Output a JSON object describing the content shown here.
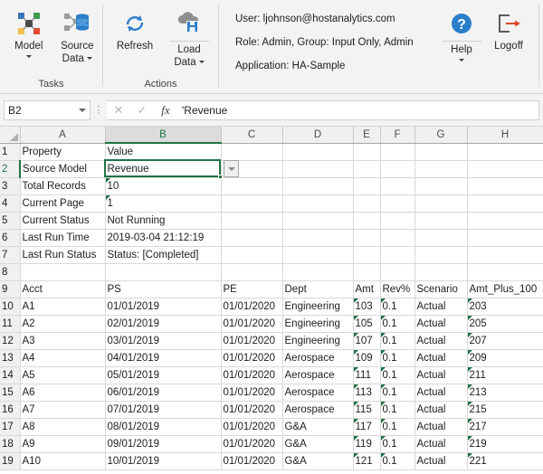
{
  "ribbon": {
    "groups": [
      {
        "label": "Tasks",
        "buttons": [
          {
            "label_line1": "Model",
            "label_line2": "",
            "icon": "model-nodes-icon",
            "has_caret": true
          },
          {
            "label_line1": "Source",
            "label_line2": "Data",
            "icon": "source-database-icon",
            "has_caret": true
          }
        ]
      },
      {
        "label": "Actions",
        "buttons": [
          {
            "label_line1": "Refresh",
            "label_line2": "",
            "icon": "refresh-icon",
            "has_caret": false
          },
          {
            "label_line1": "Load",
            "label_line2": "Data",
            "icon": "cloud-save-icon",
            "has_caret": true
          }
        ]
      }
    ],
    "info": {
      "user": "User: ljohnson@hostanalytics.com",
      "role": "Role: Admin, Group: Input Only, Admin",
      "application": "Application: HA-Sample"
    },
    "tools": [
      {
        "label": "Help",
        "icon": "help-question-icon",
        "has_caret": true
      },
      {
        "label": "Logoff",
        "icon": "logoff-arrow-icon",
        "has_caret": false
      }
    ]
  },
  "formula_bar": {
    "name_box_value": "B2",
    "cancel_icon": "✕",
    "confirm_icon": "✓",
    "fx_icon": "fx",
    "formula_value": "'Revenue"
  },
  "sheet": {
    "columns": [
      {
        "label": "A",
        "width": 94,
        "selected": false
      },
      {
        "label": "B",
        "width": 128,
        "selected": true
      },
      {
        "label": "C",
        "width": 68,
        "selected": false
      },
      {
        "label": "D",
        "width": 78,
        "selected": false
      },
      {
        "label": "E",
        "width": 30,
        "selected": false
      },
      {
        "label": "F",
        "width": 38,
        "selected": false
      },
      {
        "label": "G",
        "width": 58,
        "selected": false
      },
      {
        "label": "H",
        "width": 84,
        "selected": false
      }
    ],
    "rows": [
      {
        "num": "1",
        "selected": false,
        "cells": [
          {
            "v": "Property",
            "style": "bold"
          },
          {
            "v": "Value",
            "style": "bold"
          },
          {
            "v": ""
          },
          {
            "v": ""
          },
          {
            "v": ""
          },
          {
            "v": ""
          },
          {
            "v": ""
          },
          {
            "v": ""
          }
        ]
      },
      {
        "num": "2",
        "selected": true,
        "cells": [
          {
            "v": "Source Model",
            "style": "bold"
          },
          {
            "v": "Revenue"
          },
          {
            "v": ""
          },
          {
            "v": ""
          },
          {
            "v": ""
          },
          {
            "v": ""
          },
          {
            "v": ""
          },
          {
            "v": ""
          }
        ]
      },
      {
        "num": "3",
        "selected": false,
        "cells": [
          {
            "v": "Total Records",
            "style": "bold"
          },
          {
            "v": "10",
            "style": "gray",
            "err": true
          },
          {
            "v": ""
          },
          {
            "v": ""
          },
          {
            "v": ""
          },
          {
            "v": ""
          },
          {
            "v": ""
          },
          {
            "v": ""
          }
        ]
      },
      {
        "num": "4",
        "selected": false,
        "cells": [
          {
            "v": "Current Page",
            "style": "bold"
          },
          {
            "v": "1",
            "err": true
          },
          {
            "v": ""
          },
          {
            "v": ""
          },
          {
            "v": ""
          },
          {
            "v": ""
          },
          {
            "v": ""
          },
          {
            "v": ""
          }
        ]
      },
      {
        "num": "5",
        "selected": false,
        "cells": [
          {
            "v": "Current Status",
            "style": "bold"
          },
          {
            "v": "Not Running",
            "style": "gray"
          },
          {
            "v": ""
          },
          {
            "v": ""
          },
          {
            "v": ""
          },
          {
            "v": ""
          },
          {
            "v": ""
          },
          {
            "v": ""
          }
        ]
      },
      {
        "num": "6",
        "selected": false,
        "cells": [
          {
            "v": "Last Run Time",
            "style": "bold"
          },
          {
            "v": "2019-03-04 21:12:19",
            "style": "gray"
          },
          {
            "v": ""
          },
          {
            "v": ""
          },
          {
            "v": ""
          },
          {
            "v": ""
          },
          {
            "v": ""
          },
          {
            "v": ""
          }
        ]
      },
      {
        "num": "7",
        "selected": false,
        "cells": [
          {
            "v": "Last Run Status",
            "style": "bold"
          },
          {
            "v": "Status: [Completed]"
          },
          {
            "v": ""
          },
          {
            "v": ""
          },
          {
            "v": ""
          },
          {
            "v": ""
          },
          {
            "v": ""
          },
          {
            "v": ""
          }
        ]
      },
      {
        "num": "8",
        "selected": false,
        "cells": [
          {
            "v": ""
          },
          {
            "v": ""
          },
          {
            "v": ""
          },
          {
            "v": ""
          },
          {
            "v": ""
          },
          {
            "v": ""
          },
          {
            "v": ""
          },
          {
            "v": ""
          }
        ]
      },
      {
        "num": "9",
        "selected": false,
        "cells": [
          {
            "v": "Acct",
            "style": "bold"
          },
          {
            "v": "PS",
            "style": "bold"
          },
          {
            "v": "PE",
            "style": "bold"
          },
          {
            "v": "Dept",
            "style": "bold"
          },
          {
            "v": "Amt",
            "style": "bold"
          },
          {
            "v": "Rev%",
            "style": "bold"
          },
          {
            "v": "Scenario",
            "style": "bold"
          },
          {
            "v": "Amt_Plus_100",
            "style": "bold"
          }
        ]
      },
      {
        "num": "10",
        "selected": false,
        "cells": [
          {
            "v": "A1"
          },
          {
            "v": "01/01/2019"
          },
          {
            "v": "01/01/2020"
          },
          {
            "v": "Engineering"
          },
          {
            "v": "103",
            "err": true
          },
          {
            "v": "0.1",
            "err": true
          },
          {
            "v": "Actual"
          },
          {
            "v": "203",
            "err": true
          }
        ]
      },
      {
        "num": "11",
        "selected": false,
        "cells": [
          {
            "v": "A2"
          },
          {
            "v": "02/01/2019"
          },
          {
            "v": "01/01/2020"
          },
          {
            "v": "Engineering"
          },
          {
            "v": "105",
            "err": true
          },
          {
            "v": "0.1",
            "err": true
          },
          {
            "v": "Actual"
          },
          {
            "v": "205",
            "err": true
          }
        ]
      },
      {
        "num": "12",
        "selected": false,
        "cells": [
          {
            "v": "A3"
          },
          {
            "v": "03/01/2019"
          },
          {
            "v": "01/01/2020"
          },
          {
            "v": "Engineering"
          },
          {
            "v": "107",
            "err": true
          },
          {
            "v": "0.1",
            "err": true
          },
          {
            "v": "Actual"
          },
          {
            "v": "207",
            "err": true
          }
        ]
      },
      {
        "num": "13",
        "selected": false,
        "cells": [
          {
            "v": "A4"
          },
          {
            "v": "04/01/2019"
          },
          {
            "v": "01/01/2020"
          },
          {
            "v": "Aerospace"
          },
          {
            "v": "109",
            "err": true
          },
          {
            "v": "0.1",
            "err": true
          },
          {
            "v": "Actual"
          },
          {
            "v": "209",
            "err": true
          }
        ]
      },
      {
        "num": "14",
        "selected": false,
        "cells": [
          {
            "v": "A5"
          },
          {
            "v": "05/01/2019"
          },
          {
            "v": "01/01/2020"
          },
          {
            "v": "Aerospace"
          },
          {
            "v": "111",
            "err": true
          },
          {
            "v": "0.1",
            "err": true
          },
          {
            "v": "Actual"
          },
          {
            "v": "211",
            "err": true
          }
        ]
      },
      {
        "num": "15",
        "selected": false,
        "cells": [
          {
            "v": "A6"
          },
          {
            "v": "06/01/2019"
          },
          {
            "v": "01/01/2020"
          },
          {
            "v": "Aerospace"
          },
          {
            "v": "113",
            "err": true
          },
          {
            "v": "0.1",
            "err": true
          },
          {
            "v": "Actual"
          },
          {
            "v": "213",
            "err": true
          }
        ]
      },
      {
        "num": "16",
        "selected": false,
        "cells": [
          {
            "v": "A7"
          },
          {
            "v": "07/01/2019"
          },
          {
            "v": "01/01/2020"
          },
          {
            "v": "Aerospace"
          },
          {
            "v": "115",
            "err": true
          },
          {
            "v": "0.1",
            "err": true
          },
          {
            "v": "Actual"
          },
          {
            "v": "215",
            "err": true
          }
        ]
      },
      {
        "num": "17",
        "selected": false,
        "cells": [
          {
            "v": "A8"
          },
          {
            "v": "08/01/2019"
          },
          {
            "v": "01/01/2020"
          },
          {
            "v": "G&A"
          },
          {
            "v": "117",
            "err": true
          },
          {
            "v": "0.1",
            "err": true
          },
          {
            "v": "Actual"
          },
          {
            "v": "217",
            "err": true
          }
        ]
      },
      {
        "num": "18",
        "selected": false,
        "cells": [
          {
            "v": "A9"
          },
          {
            "v": "09/01/2019"
          },
          {
            "v": "01/01/2020"
          },
          {
            "v": "G&A"
          },
          {
            "v": "119",
            "err": true
          },
          {
            "v": "0.1",
            "err": true
          },
          {
            "v": "Actual"
          },
          {
            "v": "219",
            "err": true
          }
        ]
      },
      {
        "num": "19",
        "selected": false,
        "cells": [
          {
            "v": "A10"
          },
          {
            "v": "10/01/2019"
          },
          {
            "v": "01/01/2020"
          },
          {
            "v": "G&A"
          },
          {
            "v": "121",
            "err": true
          },
          {
            "v": "0.1",
            "err": true
          },
          {
            "v": "Actual"
          },
          {
            "v": "221",
            "err": true
          }
        ]
      }
    ],
    "active_cell": "B2",
    "dropdown_icon": "chevron-down-icon"
  },
  "colors": {
    "excel_green": "#217346",
    "accent_blue": "#2a7dc9",
    "error_triangle": "#1e7145",
    "ribbon_bg": "#f3f3f3"
  }
}
